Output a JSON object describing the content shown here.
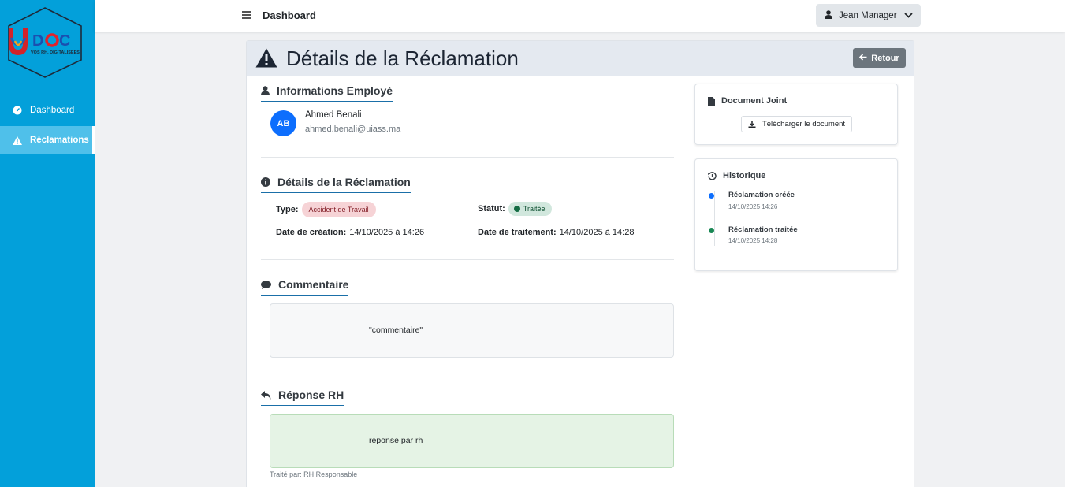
{
  "brand": {
    "logo_text": "DOC",
    "logo_letter": "U",
    "tagline": "VOS RH. DIGITALISÉES."
  },
  "sidebar": {
    "items": [
      {
        "label": "Dashboard",
        "icon": "gauge-icon"
      },
      {
        "label": "Réclamations",
        "icon": "warning-icon",
        "active": true
      }
    ]
  },
  "topbar": {
    "title": "Dashboard",
    "user": "Jean Manager"
  },
  "page": {
    "title": "Détails de la Réclamation",
    "back_label": "Retour"
  },
  "employee": {
    "section_title": "Informations Employé",
    "initials": "AB",
    "name": "Ahmed Benali",
    "email": "ahmed.benali@uiass.ma"
  },
  "details": {
    "section_title": "Détails de la Réclamation",
    "type_label": "Type:",
    "type_value": "Accident de Travail",
    "status_label": "Statut:",
    "status_value": "Traitée",
    "created_label": "Date de création:",
    "created_value": "14/10/2025 à 14:26",
    "processed_label": "Date de traitement:",
    "processed_value": "14/10/2025 à 14:28"
  },
  "comment": {
    "section_title": "Commentaire",
    "text": "\"commentaire\""
  },
  "response": {
    "section_title": "Réponse RH",
    "text": "reponse par rh",
    "treated_by": "Traité par: RH Responsable"
  },
  "document": {
    "title": "Document Joint",
    "download_label": "Télécharger le document"
  },
  "history": {
    "title": "Historique",
    "events": [
      {
        "title": "Réclamation créée",
        "date": "14/10/2025 14:26",
        "color": "#0d6efd"
      },
      {
        "title": "Réclamation traitée",
        "date": "14/10/2025 14:28",
        "color": "#198754"
      }
    ]
  },
  "colors": {
    "sidebar": "#03a0da",
    "accent": "#1a6fa8",
    "primary": "#0d6efd",
    "success": "#198754"
  }
}
